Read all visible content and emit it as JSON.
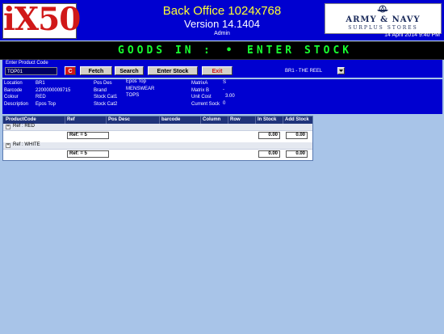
{
  "header": {
    "logo": "iX50",
    "title": "Back Office 1024x768",
    "version": "Version 14.1404",
    "user": "Admin",
    "brand_line1": "ARMY & NAVY",
    "brand_line2": "SURPLUS STORES",
    "datetime": "14 April 2014 9:40 PM"
  },
  "banner": {
    "left": "GOODS IN",
    "right": "ENTER STOCK"
  },
  "controls": {
    "product_code_label": "Enter Product Code",
    "product_code_value": "TOP01",
    "clear_label": "C",
    "fetch_label": "Fetch",
    "search_label": "Search",
    "enter_stock_label": "Enter Stock",
    "exit_label": "Exit",
    "branch": "BR1 - THE REEL"
  },
  "info": {
    "location_label": "Location",
    "location_value": "BR1",
    "barcode_label": "Barcode",
    "barcode_value": "2200000009715",
    "colour_label": "Colour",
    "colour_value": "RED",
    "description_label": "Description",
    "description_value": "Epos Top",
    "posdes_label": "Pos Des",
    "posdes_value": "Epos Top",
    "brand_label": "Brand",
    "brand_value": "MENSWEAR",
    "cat1_label": "Stock Cat1",
    "cat1_value": "TOPS",
    "cat2_label": "Stock Cat2",
    "cat2_value": "",
    "matrixa_label": "MatrixA",
    "matrixa_value": "S",
    "matrixb_label": "Matrix B",
    "matrixb_value": "-",
    "unitcost_label": "Unit Cost",
    "unitcost_value": "3.00",
    "current_stock_label": "Current Sock",
    "current_stock_value": "0"
  },
  "grid": {
    "columns": [
      "ProductCode",
      "Ref",
      "Pos Desc",
      "barcode",
      "Column",
      "Row",
      "In Stock",
      "Add Stock"
    ],
    "groups": [
      {
        "label": "Ref : RED",
        "ref": "Ref: = 5",
        "in_stock": "0.00",
        "add_stock": "0.00"
      },
      {
        "label": "Ref : WHITE",
        "ref": "Ref: = 5",
        "in_stock": "0.00",
        "add_stock": "0.00"
      }
    ]
  },
  "colors": {
    "panel_blue": "#0000d0",
    "workspace": "#a8c4e8",
    "led_green": "#18ff30",
    "title_yellow": "#ffff33"
  }
}
